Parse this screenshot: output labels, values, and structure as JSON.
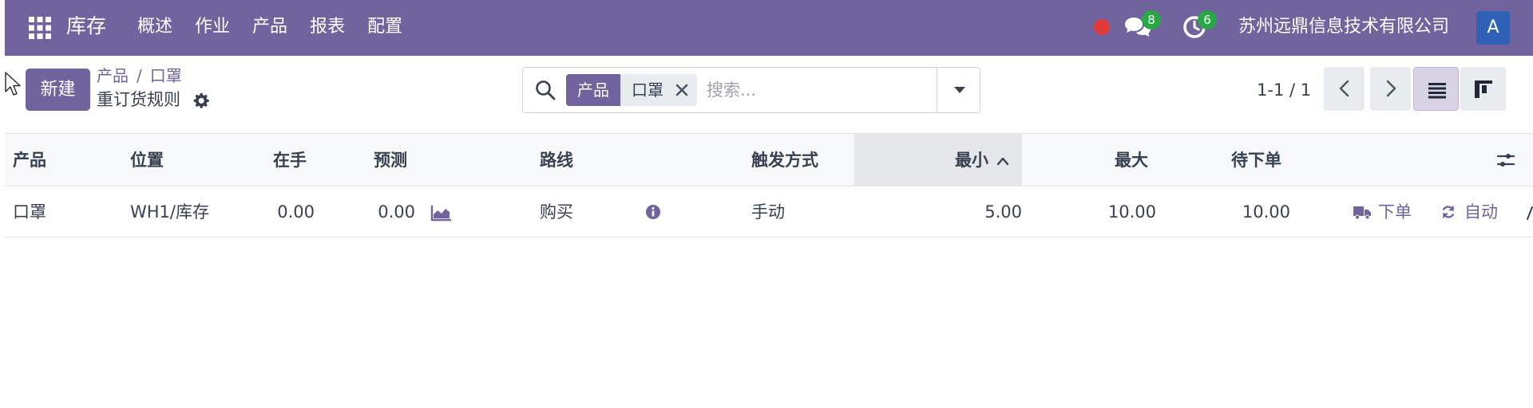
{
  "navbar": {
    "app_name": "库存",
    "menu": [
      "概述",
      "作业",
      "产品",
      "报表",
      "配置"
    ],
    "messages_badge": "8",
    "activities_badge": "6",
    "company": "苏州远鼎信息技术有限公司",
    "avatar_letter": "A"
  },
  "control_panel": {
    "new_button": "新建",
    "breadcrumb": [
      "产品",
      "口罩"
    ],
    "breadcrumb_separator": "/",
    "page_title": "重订货规则",
    "search": {
      "facet_label": "产品",
      "facet_value": "口罩",
      "placeholder": "搜索..."
    },
    "pager": "1-1 / 1"
  },
  "table": {
    "columns": [
      "产品",
      "位置",
      "在手",
      "预测",
      "路线",
      "触发方式",
      "最小",
      "最大",
      "待下单"
    ],
    "sorted_column": "最小",
    "rows": [
      {
        "product": "口罩",
        "location": "WH1/库存",
        "on_hand": "0.00",
        "forecast": "0.00",
        "route": "购买",
        "trigger": "手动",
        "min": "5.00",
        "max": "10.00",
        "to_order": "10.00",
        "order_button": "下单",
        "auto_button": "自动"
      }
    ]
  },
  "colors": {
    "brand": "#71639e",
    "badge_green": "#28a745",
    "record_red": "#e03a3a",
    "avatar_blue": "#2f62b6"
  }
}
